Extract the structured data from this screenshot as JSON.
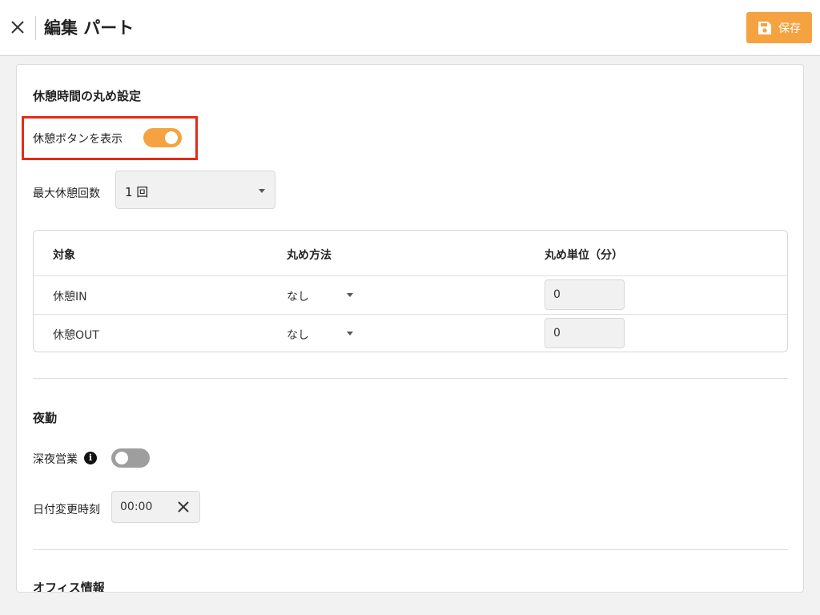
{
  "header": {
    "title": "編集 パート",
    "save_label": "保存",
    "accent_color": "#f4a340"
  },
  "break_rounding": {
    "section_title": "休憩時間の丸め設定",
    "show_break_button_label": "休憩ボタンを表示",
    "show_break_button_on": true,
    "max_breaks_label": "最大休憩回数",
    "max_breaks_value": "1 回",
    "table": {
      "headers": [
        "対象",
        "丸め方法",
        "丸め単位（分）"
      ],
      "rows": [
        {
          "target": "休憩IN",
          "method": "なし",
          "unit": "0"
        },
        {
          "target": "休憩OUT",
          "method": "なし",
          "unit": "0"
        }
      ]
    }
  },
  "night_shift": {
    "section_title": "夜勤",
    "late_night_label": "深夜営業",
    "late_night_on": false,
    "date_change_label": "日付変更時刻",
    "date_change_value": "00:00"
  },
  "office": {
    "section_title": "オフィス情報"
  },
  "icons": [
    "close-icon",
    "save-icon",
    "chevron-down-icon",
    "info-icon",
    "clear-icon"
  ]
}
